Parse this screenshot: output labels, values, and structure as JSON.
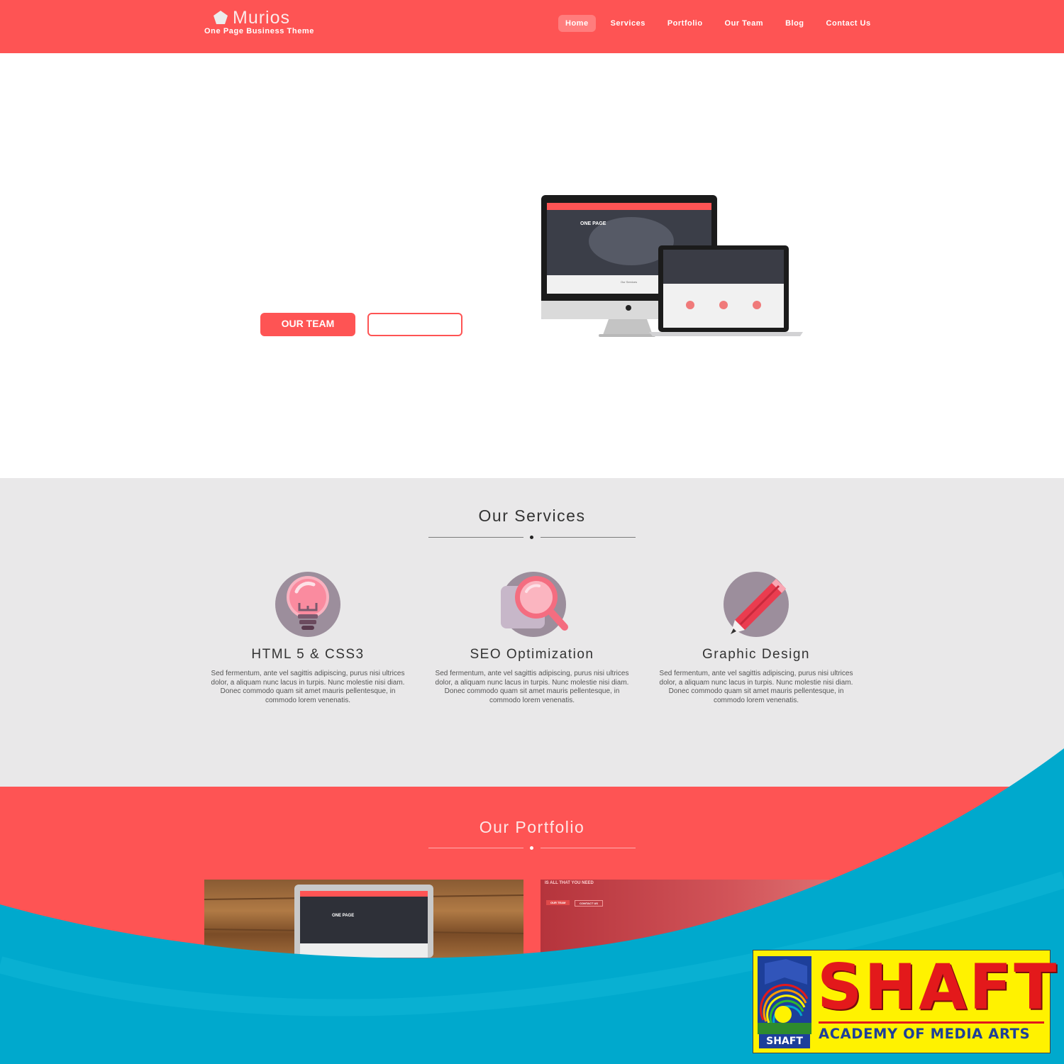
{
  "colors": {
    "brand": "#fe5454",
    "services_bg": "#e9e8e9",
    "swoosh": "#00a9cd",
    "badge_yellow": "#fff200",
    "badge_red": "#e3191b",
    "badge_blue": "#1d3f9a"
  },
  "header": {
    "logo_icon": "pentagon-icon",
    "logo_name": "Murios",
    "tagline": "One Page Business Theme",
    "nav": [
      {
        "label": "Home",
        "active": true
      },
      {
        "label": "Services",
        "active": false
      },
      {
        "label": "Portfolio",
        "active": false
      },
      {
        "label": "Our Team",
        "active": false
      },
      {
        "label": "Blog",
        "active": false
      },
      {
        "label": "Contact Us",
        "active": false
      }
    ]
  },
  "hero": {
    "primary_button": "OUR TEAM",
    "secondary_button": "",
    "mockup_imac_heading": "ONE PAGE",
    "mockup_section_label": "Our Services"
  },
  "services": {
    "title": "Our Services",
    "items": [
      {
        "icon": "lightbulb-icon",
        "title": "HTML 5 & CSS3",
        "text": "Sed fermentum, ante vel sagittis adipiscing, purus nisi ultrices dolor, a aliquam nunc lacus in turpis. Nunc molestie nisi diam. Donec commodo quam sit amet mauris pellentesque, in commodo lorem venenatis."
      },
      {
        "icon": "magnifier-icon",
        "title": "SEO Optimization",
        "text": "Sed fermentum, ante vel sagittis adipiscing, purus nisi ultrices dolor, a aliquam nunc lacus in turpis. Nunc molestie nisi diam. Donec commodo quam sit amet mauris pellentesque, in commodo lorem venenatis."
      },
      {
        "icon": "pencil-icon",
        "title": "Graphic Design",
        "text": "Sed fermentum, ante vel sagittis adipiscing, purus nisi ultrices dolor, a aliquam nunc lacus in turpis. Nunc molestie nisi diam. Donec commodo quam sit amet mauris pellentesque, in commodo lorem venenatis."
      }
    ]
  },
  "portfolio": {
    "title": "Our Portfolio",
    "thumb1_caption": "ONE PAGE",
    "thumb2_caption": "IS ALL THAT YOU NEED",
    "thumb2_btn1": "OUR TEAM",
    "thumb2_btn2": "CONTACT US"
  },
  "badge": {
    "small_label": "SHAFT",
    "title": "SHAFT",
    "subtitle": "ACADEMY OF MEDIA ARTS"
  }
}
